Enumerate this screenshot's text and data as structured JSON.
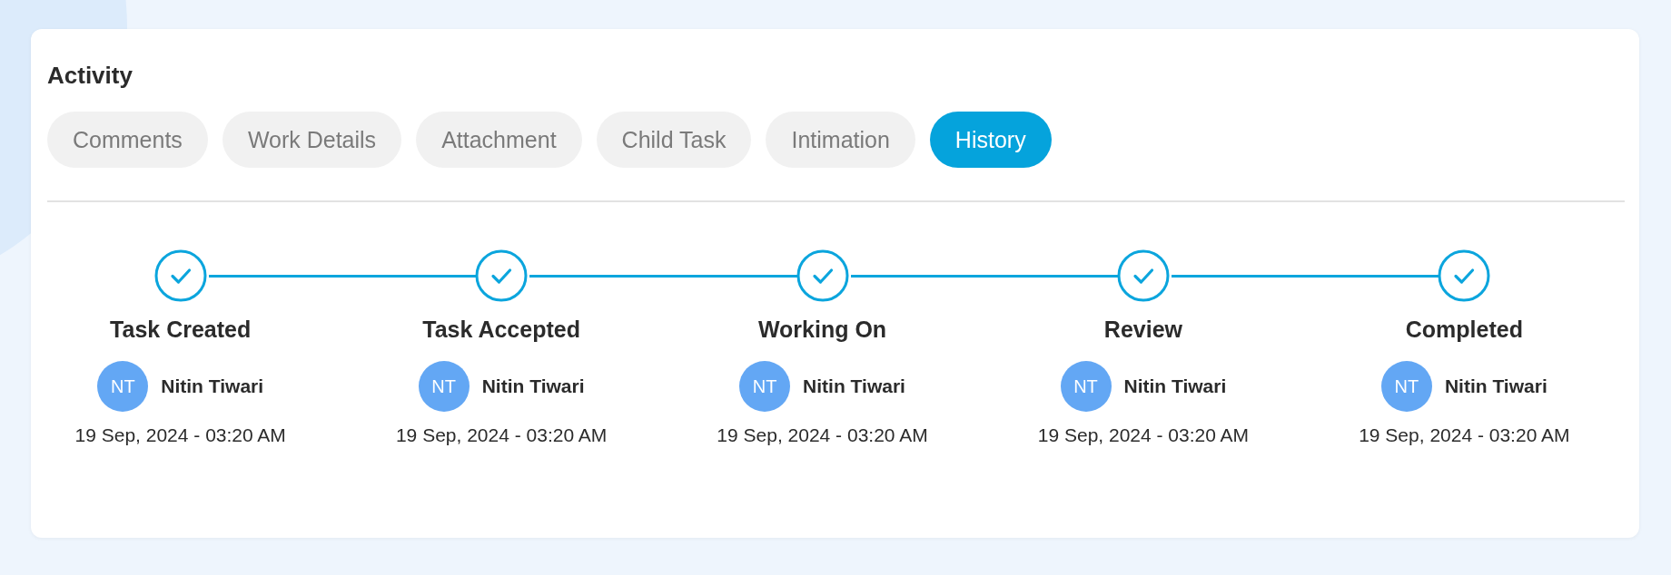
{
  "title": "Activity",
  "tabs": [
    {
      "label": "Comments",
      "selected": false
    },
    {
      "label": "Work Details",
      "selected": false
    },
    {
      "label": "Attachment",
      "selected": false
    },
    {
      "label": "Child Task",
      "selected": false
    },
    {
      "label": "Intimation",
      "selected": false
    },
    {
      "label": "History",
      "selected": true
    }
  ],
  "steps": [
    {
      "title": "Task Created",
      "done": true,
      "initials": "NT",
      "user": "Nitin Tiwari",
      "time": "19 Sep, 2024 - 03:20 AM"
    },
    {
      "title": "Task Accepted",
      "done": true,
      "initials": "NT",
      "user": "Nitin Tiwari",
      "time": "19 Sep, 2024 - 03:20 AM"
    },
    {
      "title": "Working On",
      "done": true,
      "initials": "NT",
      "user": "Nitin Tiwari",
      "time": "19 Sep, 2024 - 03:20 AM"
    },
    {
      "title": "Review",
      "done": true,
      "initials": "NT",
      "user": "Nitin Tiwari",
      "time": "19 Sep, 2024 - 03:20 AM"
    },
    {
      "title": "Completed",
      "done": true,
      "initials": "NT",
      "user": "Nitin Tiwari",
      "time": "19 Sep, 2024 - 03:20 AM"
    }
  ]
}
